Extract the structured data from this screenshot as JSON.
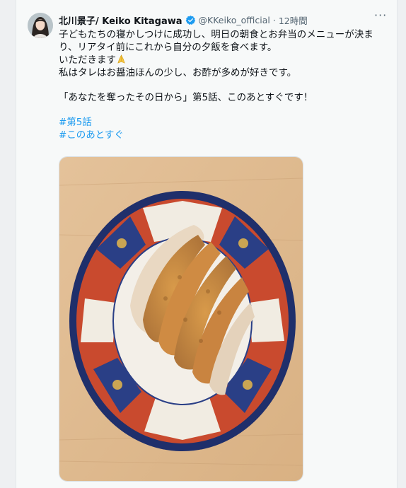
{
  "tweet": {
    "author_name": "北川景子/ Keiko Kitagawa",
    "handle": "@KKeiko_official",
    "separator": "·",
    "time": "12時間",
    "more_label": "···",
    "line1": "子どもたちの寝かしつけに成功し、明日の朝食とお弁当のメニューが決まり、リアタイ前にこれから自分の夕飯を食べます。",
    "line2": "いただきます",
    "line3": "私はタレはお醤油ほんの少し、お酢が多めが好きです。",
    "line4": "「あなたを奪ったその日から」第5話、このあとすぐです！",
    "hashtags": [
      "#第5話",
      "#このあとすぐ"
    ]
  },
  "colors": {
    "link": "#1d9bf0",
    "verified": "#1d9bf0",
    "secondary_text": "#536471"
  },
  "icons": {
    "verified": "verified-badge-icon",
    "more": "more-options-icon",
    "emoji": "folded-hands-emoji"
  }
}
